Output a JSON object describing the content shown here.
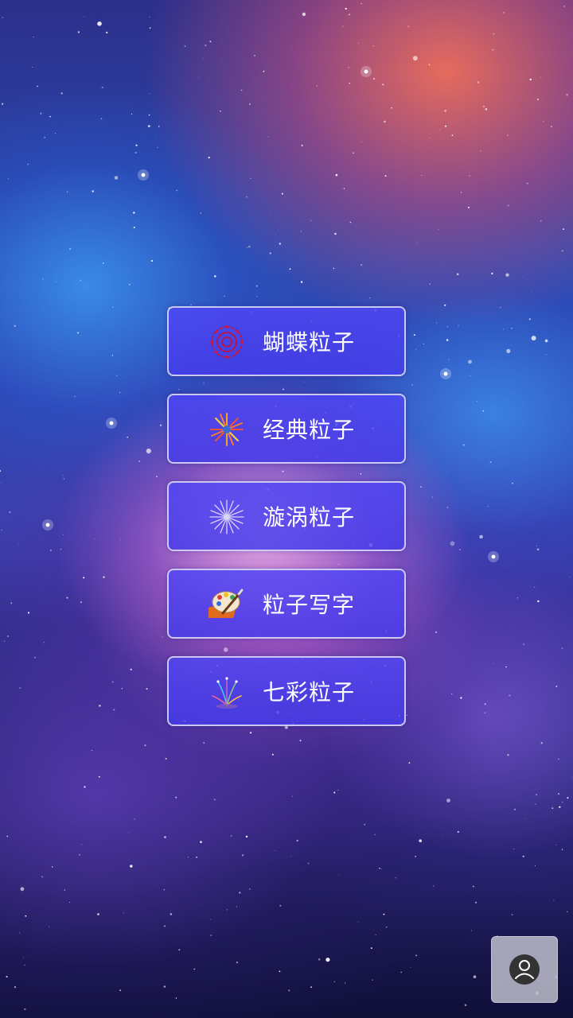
{
  "menu": {
    "items": [
      {
        "label": "蝴蝶粒子",
        "icon": "red-firework-icon"
      },
      {
        "label": "经典粒子",
        "icon": "orange-firework-icon"
      },
      {
        "label": "漩涡粒子",
        "icon": "white-swirl-icon"
      },
      {
        "label": "粒子写字",
        "icon": "paint-palette-icon"
      },
      {
        "label": "七彩粒子",
        "icon": "colorful-firework-icon"
      }
    ]
  },
  "user_button": {
    "icon": "user-avatar-icon"
  },
  "colors": {
    "button_fill": "#4f44f0",
    "button_border": "#e1e1f5",
    "label_text": "#ffffff"
  }
}
